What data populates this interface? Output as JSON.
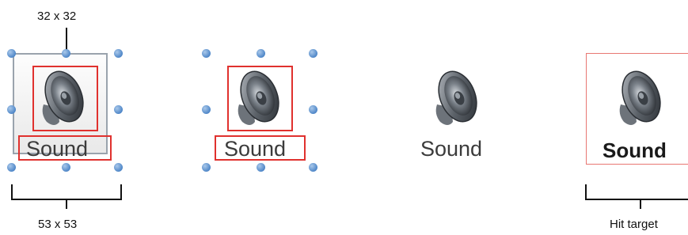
{
  "labels": {
    "top_size": "32 x 32",
    "bottom_size": "53 x 53",
    "hit_target": "Hit target"
  },
  "icon": {
    "name": "speaker-icon",
    "caption": "Sound"
  },
  "colors": {
    "handle": "#4f87c8",
    "highlight": "#e0312e",
    "hit_target_border": "#e87772",
    "frame": "#9aa3ad"
  }
}
